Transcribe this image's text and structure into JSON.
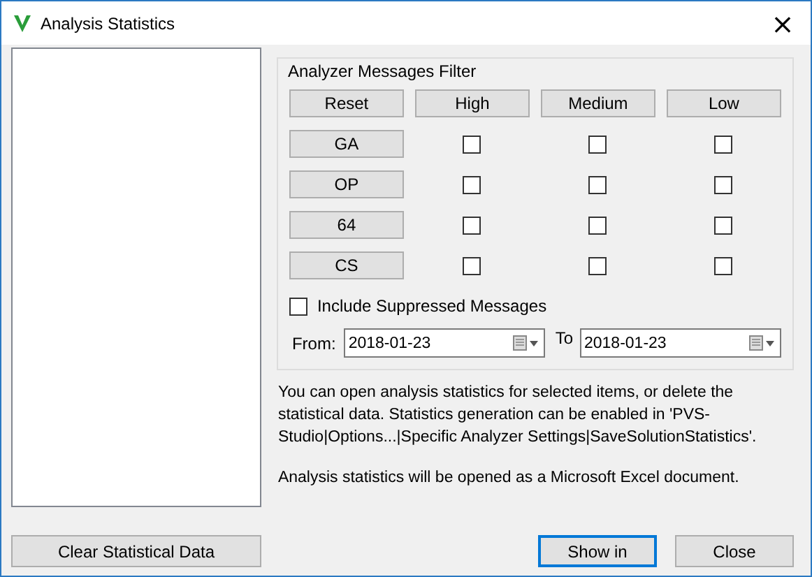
{
  "window": {
    "title": "Analysis Statistics",
    "close": "×"
  },
  "filter": {
    "title": "Analyzer Messages Filter",
    "header": [
      {
        "label": "Reset"
      },
      {
        "label": "High"
      },
      {
        "label": "Medium"
      },
      {
        "label": "Low"
      }
    ],
    "rows": [
      {
        "label": "GA",
        "checks": [
          {
            "checked": false
          },
          {
            "checked": false
          },
          {
            "checked": false
          }
        ]
      },
      {
        "label": "OP",
        "checks": [
          {
            "checked": false
          },
          {
            "checked": false
          },
          {
            "checked": false
          }
        ]
      },
      {
        "label": "64",
        "checks": [
          {
            "checked": false
          },
          {
            "checked": false
          },
          {
            "checked": false
          }
        ]
      },
      {
        "label": "CS",
        "checks": [
          {
            "checked": false
          },
          {
            "checked": false
          },
          {
            "checked": false
          }
        ]
      }
    ],
    "suppressed": {
      "label": "Include Suppressed Messages",
      "checked": false
    },
    "from": {
      "label": "From:",
      "value": "2018-01-23"
    },
    "to": {
      "label": "To",
      "value": "2018-01-23"
    }
  },
  "info": [
    "You can open analysis statistics for selected items, or delete the statistical data. Statistics generation can be enabled in 'PVS-Studio|Options...|Specific Analyzer Settings|SaveSolutionStatistics'.",
    "Analysis statistics will be opened as a Microsoft Excel document."
  ],
  "buttons": {
    "clear": "Clear Statistical Data",
    "show": "Show in",
    "close": "Close"
  }
}
